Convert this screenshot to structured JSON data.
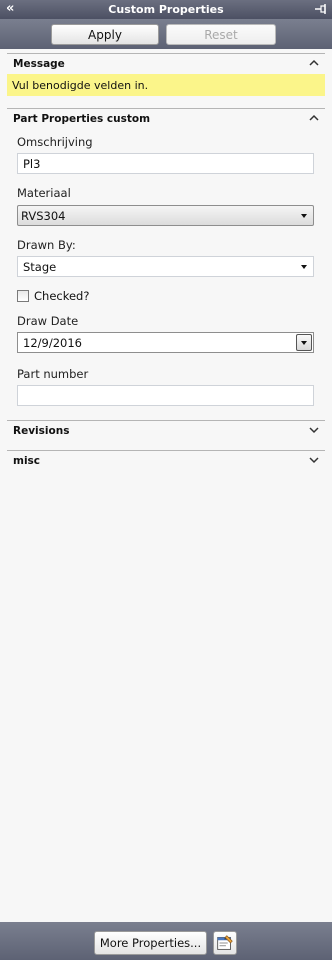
{
  "window": {
    "title": "Custom Properties",
    "collapse_glyph": "«"
  },
  "toolbar": {
    "apply_label": "Apply",
    "reset_label": "Reset"
  },
  "sections": {
    "message": {
      "title": "Message",
      "text": "Vul benodigde velden in.",
      "highlight_color": "#fbf58a"
    },
    "part_properties": {
      "title": "Part Properties custom",
      "fields": {
        "omschrijving": {
          "label": "Omschrijving",
          "value": "Pl3"
        },
        "materiaal": {
          "label": "Materiaal",
          "value": "RVS304"
        },
        "drawn_by": {
          "label": "Drawn By:",
          "value": "Stage"
        },
        "checked": {
          "label": "Checked?",
          "checked": false
        },
        "draw_date": {
          "label": "Draw Date",
          "value": "12/9/2016"
        },
        "part_number": {
          "label": "Part number",
          "value": ""
        }
      }
    },
    "revisions": {
      "title": "Revisions"
    },
    "misc": {
      "title": "misc"
    }
  },
  "footer": {
    "more_properties_label": "More Properties..."
  }
}
